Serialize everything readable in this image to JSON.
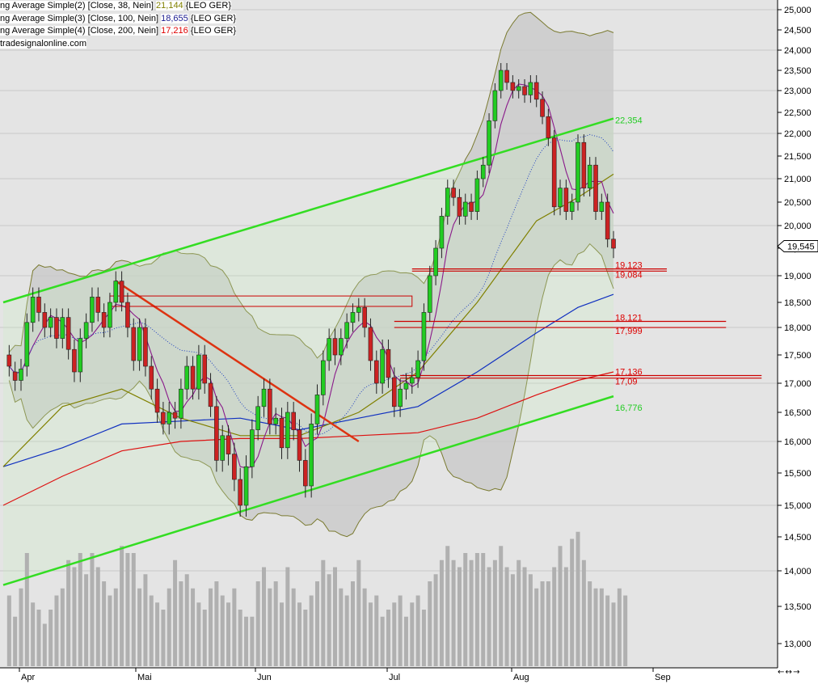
{
  "legend": {
    "line1_prefix": "ng Average Simple(2) [Close, 38, Nein]",
    "line1_value": "21,144",
    "line1_suffix": "{LEO GER}",
    "line2_prefix": "ng Average Simple(3) [Close, 100, Nein]",
    "line2_value": "18,655",
    "line2_suffix": "{LEO GER}",
    "line3_prefix": "ng Average Simple(4) [Close, 200, Nein]",
    "line3_value": "17,216",
    "line3_suffix": "{LEO GER}",
    "line4": "tradesignalonline.com"
  },
  "corner_controls": "← ↔ →",
  "colors": {
    "candle_up": "#22cc22",
    "candle_down": "#cc2222",
    "channel": "#33dd22",
    "sma38": "#808000",
    "sma100": "#1030c0",
    "sma200": "#dd1111",
    "trendline": "#dd3311",
    "volume": "#b0b0b0",
    "bollinger_fill": "#c8c8c8"
  },
  "chart_data": {
    "type": "candlestick",
    "symbol": "LEO GER",
    "y_axis": {
      "range": [
        12.7,
        25.1
      ],
      "ticks": [
        "25,000",
        "24,500",
        "24,000",
        "23,500",
        "23,000",
        "22,500",
        "22,000",
        "21,500",
        "21,000",
        "20,500",
        "20,000",
        "19,500",
        "19,000",
        "18,500",
        "18,000",
        "17,500",
        "17,000",
        "16,500",
        "16,000",
        "15,500",
        "15,000",
        "14,500",
        "14,000",
        "13,500",
        "13,000"
      ],
      "last_price": "19,545"
    },
    "x_axis": {
      "months": [
        "Apr",
        "Mai",
        "Jun",
        "Jul",
        "Aug",
        "Sep"
      ],
      "month_positions": [
        24,
        168,
        316,
        479,
        633,
        808
      ]
    },
    "candles": [
      [
        1,
        17.5,
        17.3
      ],
      [
        2,
        17.2,
        17.05
      ],
      [
        3,
        17.05,
        17.25
      ],
      [
        4,
        17.3,
        18.1
      ],
      [
        5,
        18.1,
        18.6
      ],
      [
        6,
        18.6,
        18.3
      ],
      [
        7,
        18.3,
        18.0
      ],
      [
        8,
        18.0,
        18.2
      ],
      [
        9,
        18.2,
        17.8
      ],
      [
        10,
        17.8,
        18.2
      ],
      [
        11,
        18.2,
        17.6
      ],
      [
        12,
        17.6,
        17.2
      ],
      [
        13,
        17.2,
        17.8
      ],
      [
        14,
        17.8,
        18.1
      ],
      [
        15,
        18.1,
        18.6
      ],
      [
        16,
        18.6,
        18.3
      ],
      [
        17,
        18.3,
        18.0
      ],
      [
        18,
        18.0,
        18.5
      ],
      [
        19,
        18.5,
        18.9
      ],
      [
        20,
        18.9,
        18.5
      ],
      [
        21,
        18.5,
        18.0
      ],
      [
        22,
        18.0,
        17.4
      ],
      [
        23,
        17.4,
        18.0
      ],
      [
        24,
        18.0,
        17.3
      ],
      [
        25,
        17.3,
        16.9
      ],
      [
        26,
        16.9,
        16.5
      ],
      [
        27,
        16.5,
        16.3
      ],
      [
        28,
        16.3,
        16.5
      ],
      [
        29,
        16.5,
        16.4
      ],
      [
        30,
        16.4,
        16.9
      ],
      [
        31,
        16.9,
        17.3
      ],
      [
        32,
        17.3,
        16.9
      ],
      [
        33,
        16.9,
        17.5
      ],
      [
        34,
        17.5,
        17.0
      ],
      [
        35,
        17.0,
        16.6
      ],
      [
        36,
        16.6,
        15.7
      ],
      [
        37,
        15.7,
        16.1
      ],
      [
        38,
        16.1,
        15.8
      ],
      [
        39,
        15.8,
        15.4
      ],
      [
        40,
        15.4,
        15.0
      ],
      [
        41,
        15.0,
        15.6
      ],
      [
        42,
        15.6,
        16.2
      ],
      [
        43,
        16.2,
        16.6
      ],
      [
        44,
        16.6,
        16.9
      ],
      [
        45,
        16.9,
        16.3
      ],
      [
        46,
        16.3,
        16.4
      ],
      [
        47,
        16.4,
        15.9
      ],
      [
        48,
        15.9,
        16.5
      ],
      [
        49,
        16.5,
        16.2
      ],
      [
        50,
        16.2,
        15.7
      ],
      [
        51,
        15.7,
        15.3
      ],
      [
        52,
        15.3,
        16.3
      ],
      [
        53,
        16.3,
        16.8
      ],
      [
        54,
        16.8,
        17.4
      ],
      [
        55,
        17.4,
        17.8
      ],
      [
        56,
        17.8,
        17.5
      ],
      [
        57,
        17.5,
        17.8
      ],
      [
        58,
        17.8,
        18.1
      ],
      [
        59,
        18.1,
        18.3
      ],
      [
        60,
        18.3,
        18.4
      ],
      [
        61,
        18.4,
        18.0
      ],
      [
        62,
        18.0,
        17.4
      ],
      [
        63,
        17.4,
        17.0
      ],
      [
        64,
        17.0,
        17.6
      ],
      [
        65,
        17.6,
        17.1
      ],
      [
        66,
        17.1,
        16.6
      ],
      [
        67,
        16.6,
        16.9
      ],
      [
        68,
        16.9,
        17.0
      ],
      [
        69,
        17.0,
        17.1
      ],
      [
        70,
        17.1,
        17.4
      ],
      [
        71,
        17.4,
        18.3
      ],
      [
        72,
        18.3,
        19.0
      ],
      [
        73,
        19.0,
        19.5
      ],
      [
        74,
        19.5,
        20.2
      ],
      [
        75,
        20.2,
        20.8
      ],
      [
        76,
        20.8,
        20.6
      ],
      [
        77,
        20.6,
        20.2
      ],
      [
        78,
        20.2,
        20.5
      ],
      [
        79,
        20.5,
        20.3
      ],
      [
        80,
        20.3,
        21.0
      ],
      [
        81,
        21.0,
        21.3
      ],
      [
        82,
        21.3,
        22.3
      ],
      [
        83,
        22.3,
        23.0
      ],
      [
        84,
        23.0,
        23.5
      ],
      [
        85,
        23.5,
        23.2
      ],
      [
        86,
        23.2,
        23.0
      ],
      [
        87,
        23.0,
        23.1
      ],
      [
        88,
        23.1,
        22.9
      ],
      [
        89,
        22.9,
        23.2
      ],
      [
        90,
        23.2,
        22.8
      ],
      [
        91,
        22.8,
        22.4
      ],
      [
        92,
        22.4,
        21.9
      ],
      [
        93,
        21.9,
        20.4
      ],
      [
        94,
        20.4,
        20.8
      ],
      [
        95,
        20.8,
        20.3
      ],
      [
        96,
        20.3,
        20.5
      ],
      [
        97,
        20.5,
        21.8
      ],
      [
        98,
        21.8,
        20.8
      ],
      [
        99,
        20.8,
        21.3
      ],
      [
        100,
        21.3,
        20.3
      ],
      [
        101,
        20.3,
        20.5
      ],
      [
        102,
        20.5,
        19.7
      ],
      [
        103,
        19.7,
        19.5
      ]
    ],
    "sma38": [
      [
        0,
        15.6
      ],
      [
        10,
        16.6
      ],
      [
        20,
        16.9
      ],
      [
        30,
        16.4
      ],
      [
        40,
        16.1
      ],
      [
        50,
        16.1
      ],
      [
        60,
        16.5
      ],
      [
        70,
        17.2
      ],
      [
        80,
        18.5
      ],
      [
        90,
        20.1
      ],
      [
        97,
        20.6
      ],
      [
        103,
        21.1
      ]
    ],
    "sma100": [
      [
        0,
        15.6
      ],
      [
        10,
        15.9
      ],
      [
        20,
        16.3
      ],
      [
        30,
        16.35
      ],
      [
        40,
        16.4
      ],
      [
        50,
        16.2
      ],
      [
        60,
        16.4
      ],
      [
        70,
        16.6
      ],
      [
        80,
        17.2
      ],
      [
        90,
        17.9
      ],
      [
        97,
        18.4
      ],
      [
        103,
        18.65
      ]
    ],
    "sma200": [
      [
        0,
        15.0
      ],
      [
        10,
        15.45
      ],
      [
        20,
        15.85
      ],
      [
        30,
        16.0
      ],
      [
        40,
        16.05
      ],
      [
        50,
        16.05
      ],
      [
        60,
        16.1
      ],
      [
        70,
        16.15
      ],
      [
        80,
        16.4
      ],
      [
        90,
        16.8
      ],
      [
        97,
        17.05
      ],
      [
        103,
        17.2
      ]
    ],
    "channel_upper": {
      "from": [
        0,
        18.5
      ],
      "to": [
        103,
        22.354
      ],
      "label": "22,354"
    },
    "channel_lower": {
      "from": [
        0,
        13.8
      ],
      "to": [
        103,
        16.776
      ],
      "label": "16,776"
    },
    "trendline": [
      [
        19,
        18.9
      ],
      [
        60,
        16.0
      ]
    ],
    "horizontal_levels": [
      {
        "value": 19.123,
        "label": "19,123",
        "end": 112
      },
      {
        "value": 19.084,
        "label": "19,084",
        "end": 112
      },
      {
        "value": 18.121,
        "label": "18,121",
        "end": 122
      },
      {
        "value": 17.999,
        "label": "17,999",
        "end": 122
      },
      {
        "value": 17.136,
        "label": "17,136",
        "end": 128
      },
      {
        "value": 17.09,
        "label": "17,09",
        "end": 128
      }
    ],
    "volume_relative": [
      0.5,
      0.35,
      0.55,
      0.8,
      0.45,
      0.4,
      0.3,
      0.4,
      0.5,
      0.55,
      0.75,
      0.7,
      0.8,
      0.65,
      0.8,
      0.7,
      0.6,
      0.5,
      0.55,
      0.85,
      0.8,
      0.8,
      0.55,
      0.65,
      0.5,
      0.45,
      0.4,
      0.55,
      0.75,
      0.6,
      0.65,
      0.55,
      0.45,
      0.4,
      0.55,
      0.6,
      0.5,
      0.45,
      0.55,
      0.4,
      0.35,
      0.35,
      0.6,
      0.7,
      0.55,
      0.6,
      0.45,
      0.7,
      0.55,
      0.45,
      0.4,
      0.5,
      0.6,
      0.75,
      0.65,
      0.7,
      0.55,
      0.5,
      0.6,
      0.75,
      0.55,
      0.45,
      0.5,
      0.35,
      0.4,
      0.45,
      0.5,
      0.35,
      0.45,
      0.5,
      0.4,
      0.6,
      0.65,
      0.75,
      0.85,
      0.75,
      0.7,
      0.8,
      0.75,
      0.8,
      0.8,
      0.7,
      0.75,
      0.85,
      0.7,
      0.65,
      0.75,
      0.7,
      0.65,
      0.55,
      0.6,
      0.6,
      0.7,
      0.85,
      0.7,
      0.9,
      0.95,
      0.75,
      0.6,
      0.55,
      0.55,
      0.5,
      0.45,
      0.55,
      0.5
    ]
  }
}
